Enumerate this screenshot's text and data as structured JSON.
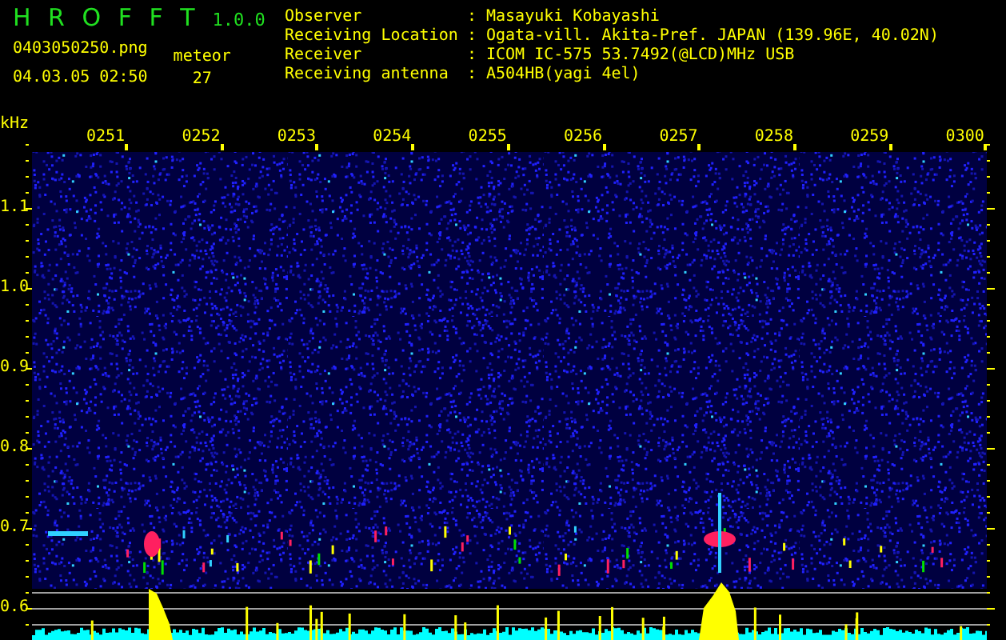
{
  "app": {
    "title": "H R O F F T",
    "version": "1.0.0",
    "filename": "0403050250.png",
    "datetime": "04.03.05 02:50",
    "meteor_label": "meteor",
    "meteor_count": "27"
  },
  "info": [
    {
      "label": "Observer",
      "colon": ":",
      "value": "Masayuki Kobayashi"
    },
    {
      "label": "Receiving Location",
      "colon": ":",
      "value": "Ogata-vill. Akita-Pref. JAPAN (139.96E, 40.02N)"
    },
    {
      "label": "Receiver",
      "colon": ":",
      "value": "ICOM IC-575 53.7492(@LCD)MHz USB"
    },
    {
      "label": "Receiving antenna",
      "colon": ":",
      "value": "A504HB(yagi 4el)"
    }
  ],
  "plot": {
    "unit": "kHz",
    "y_labels": [
      "1.1",
      "1.0",
      "0.9",
      "0.8",
      "0.7",
      "0.6"
    ],
    "time_labels": [
      "0251",
      "0252",
      "0253",
      "0254",
      "0255",
      "0256",
      "0257",
      "0258",
      "0259",
      "0300"
    ]
  }
}
